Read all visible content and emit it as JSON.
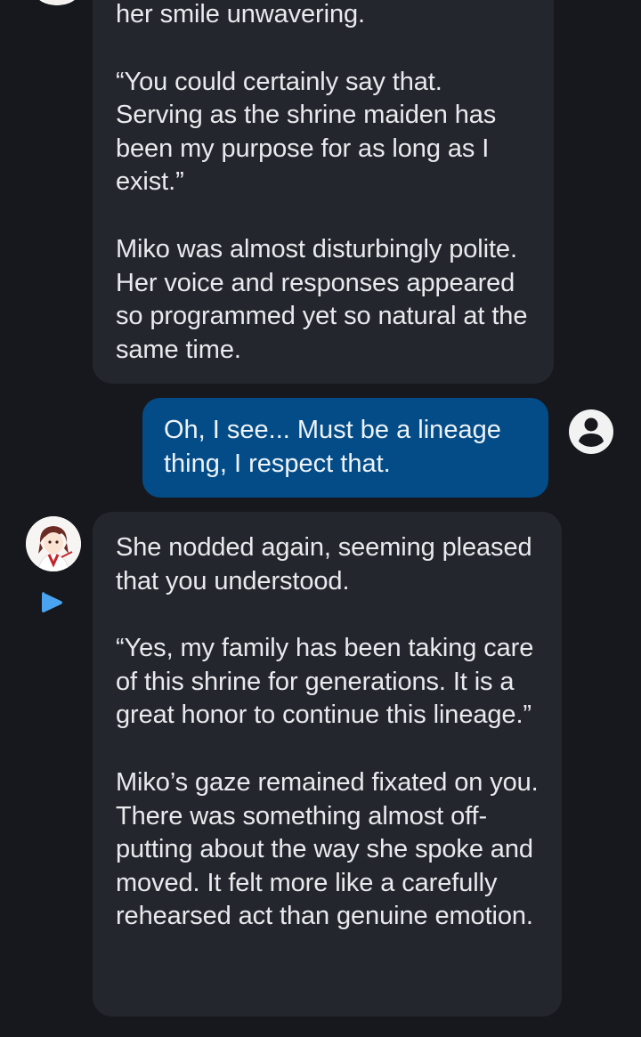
{
  "messages": [
    {
      "role": "bot",
      "paragraphs": [
        "her smile unwavering.",
        "“You could certainly say that. Serving as the shrine maiden has been my purpose for as long as I exist.”",
        "Miko was almost disturbingly polite. Her voice and responses appeared so programmed yet so natural at the same time."
      ]
    },
    {
      "role": "user",
      "text": "Oh, I see... Must be a lineage thing, I respect that."
    },
    {
      "role": "bot",
      "paragraphs": [
        "She nodded again, seeming pleased that you understood.",
        "“Yes, my family has been taking care of this shrine for generations. It is a great honor to continue this lineage.”",
        "Miko’s gaze remained fixated on you. There was something almost off-putting about the way she spoke and moved. It felt more like a carefully rehearsed act than genuine emotion."
      ]
    }
  ],
  "icons": {
    "play": "play-icon",
    "user": "user-account-icon",
    "bot_avatar": "character-avatar"
  },
  "colors": {
    "background": "#16181d",
    "bot_bubble": "#23262d",
    "user_bubble": "#034c87",
    "play_accent": "#4aa3f0",
    "text": "#e9eaed"
  }
}
